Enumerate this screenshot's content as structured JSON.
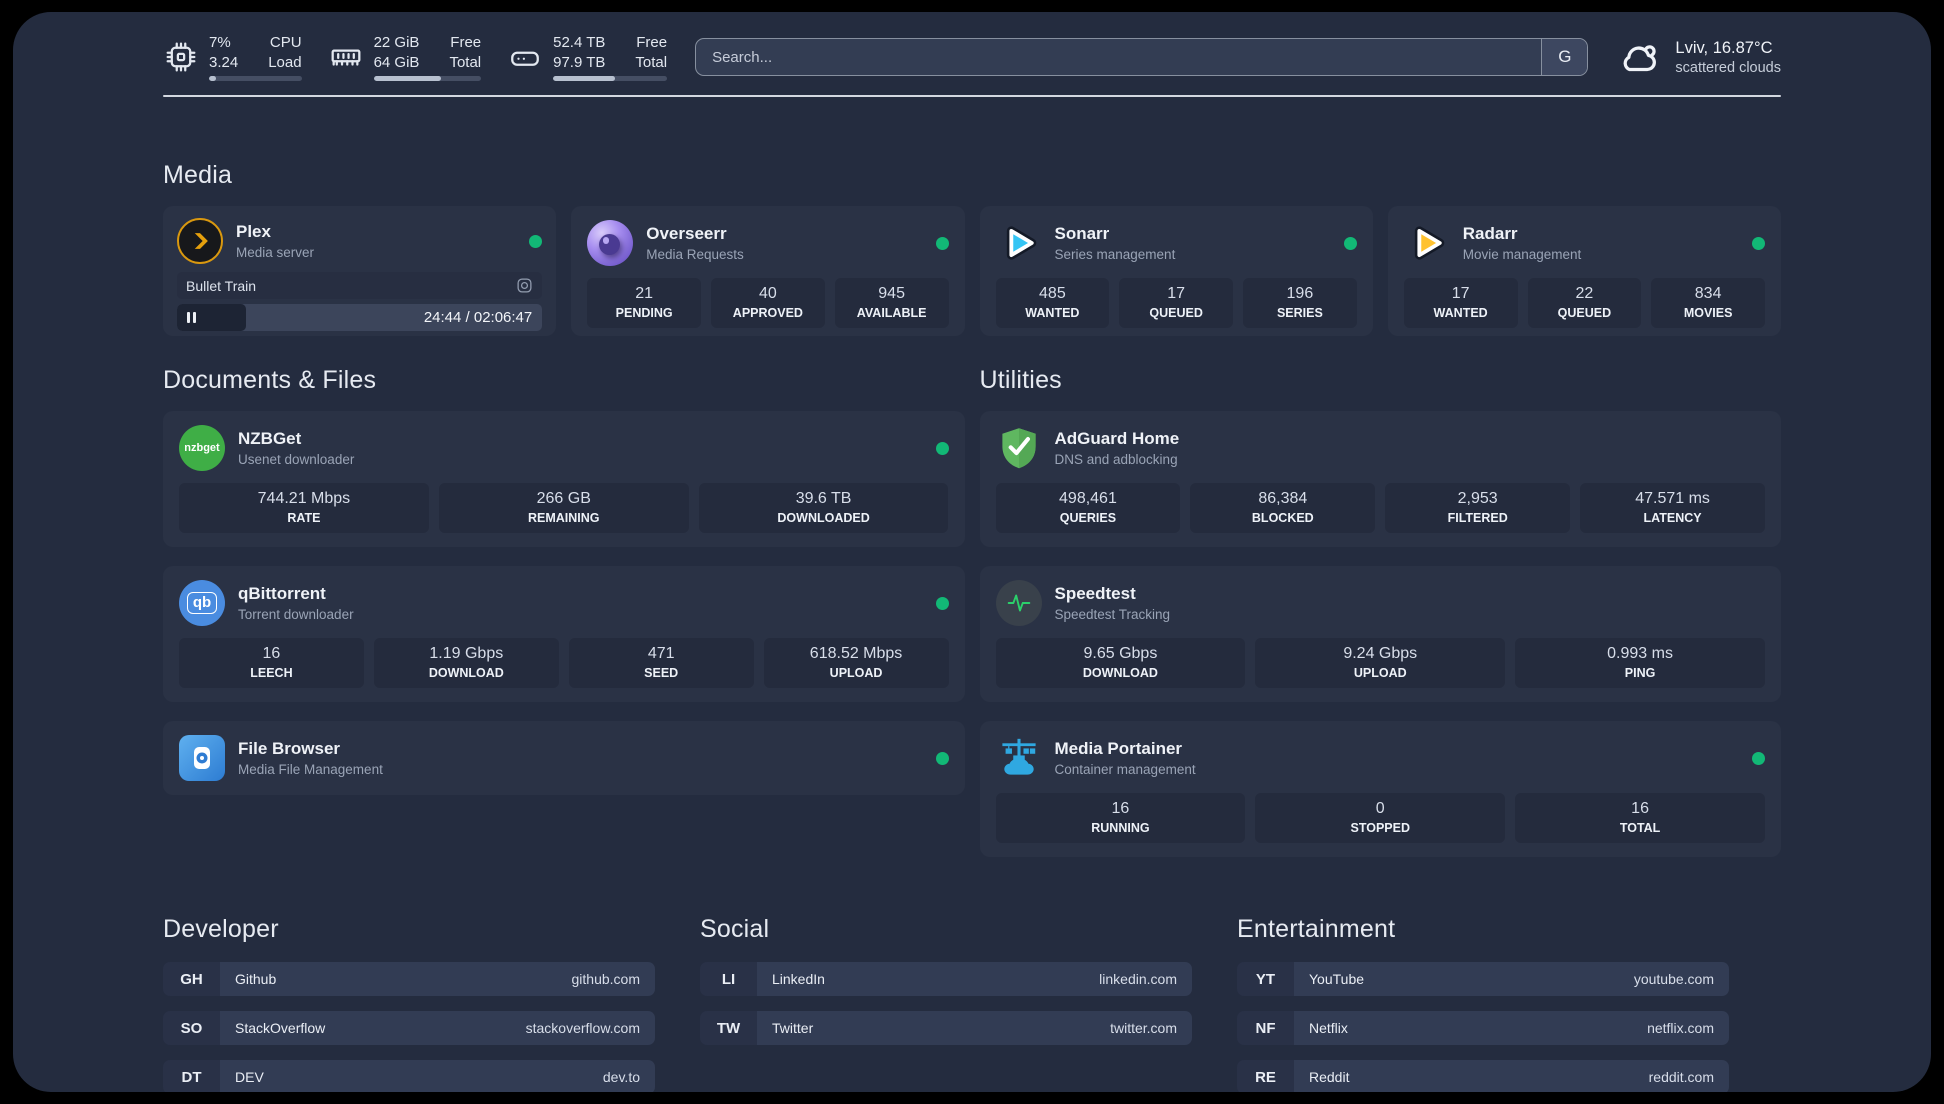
{
  "topbar": {
    "cpu": {
      "value1": "7%",
      "value2": "3.24",
      "label1": "CPU",
      "label2": "Load",
      "progress": 8
    },
    "memory": {
      "value1": "22 GiB",
      "value2": "64 GiB",
      "label1": "Free",
      "label2": "Total",
      "progress": 63
    },
    "storage": {
      "value1": "52.4 TB",
      "value2": "97.9 TB",
      "label1": "Free",
      "label2": "Total",
      "progress": 54
    },
    "search": {
      "placeholder": "Search...",
      "engine_button": "G"
    },
    "weather": {
      "location": "Lviv, 16.87°C",
      "condition": "scattered clouds"
    }
  },
  "sections": {
    "media": "Media",
    "documents": "Documents & Files",
    "utilities": "Utilities",
    "developer": "Developer",
    "social": "Social",
    "entertainment": "Entertainment"
  },
  "apps": {
    "plex": {
      "name": "Plex",
      "description": "Media server",
      "now_playing": "Bullet Train",
      "time_display": "24:44 / 02:06:47",
      "progress": 19
    },
    "overseerr": {
      "name": "Overseerr",
      "description": "Media Requests",
      "stats": [
        {
          "value": "21",
          "label": "PENDING"
        },
        {
          "value": "40",
          "label": "APPROVED"
        },
        {
          "value": "945",
          "label": "AVAILABLE"
        }
      ]
    },
    "sonarr": {
      "name": "Sonarr",
      "description": "Series management",
      "stats": [
        {
          "value": "485",
          "label": "WANTED"
        },
        {
          "value": "17",
          "label": "QUEUED"
        },
        {
          "value": "196",
          "label": "SERIES"
        }
      ]
    },
    "radarr": {
      "name": "Radarr",
      "description": "Movie management",
      "stats": [
        {
          "value": "17",
          "label": "WANTED"
        },
        {
          "value": "22",
          "label": "QUEUED"
        },
        {
          "value": "834",
          "label": "MOVIES"
        }
      ]
    },
    "nzbget": {
      "name": "NZBGet",
      "description": "Usenet downloader",
      "icon_text": "nzbget",
      "stats": [
        {
          "value": "744.21 Mbps",
          "label": "RATE"
        },
        {
          "value": "266 GB",
          "label": "REMAINING"
        },
        {
          "value": "39.6 TB",
          "label": "DOWNLOADED"
        }
      ]
    },
    "qbittorrent": {
      "name": "qBittorrent",
      "description": "Torrent downloader",
      "icon_text": "qb",
      "stats": [
        {
          "value": "16",
          "label": "LEECH"
        },
        {
          "value": "1.19 Gbps",
          "label": "DOWNLOAD"
        },
        {
          "value": "471",
          "label": "SEED"
        },
        {
          "value": "618.52 Mbps",
          "label": "UPLOAD"
        }
      ]
    },
    "filebrowser": {
      "name": "File Browser",
      "description": "Media File Management"
    },
    "adguard": {
      "name": "AdGuard Home",
      "description": "DNS and adblocking",
      "stats": [
        {
          "value": "498,461",
          "label": "QUERIES"
        },
        {
          "value": "86,384",
          "label": "BLOCKED"
        },
        {
          "value": "2,953",
          "label": "FILTERED"
        },
        {
          "value": "47.571 ms",
          "label": "LATENCY"
        }
      ]
    },
    "speedtest": {
      "name": "Speedtest",
      "description": "Speedtest Tracking",
      "stats": [
        {
          "value": "9.65 Gbps",
          "label": "DOWNLOAD"
        },
        {
          "value": "9.24 Gbps",
          "label": "UPLOAD"
        },
        {
          "value": "0.993 ms",
          "label": "PING"
        }
      ]
    },
    "portainer": {
      "name": "Media Portainer",
      "description": "Container management",
      "stats": [
        {
          "value": "16",
          "label": "RUNNING"
        },
        {
          "value": "0",
          "label": "STOPPED"
        },
        {
          "value": "16",
          "label": "TOTAL"
        }
      ]
    }
  },
  "links": {
    "developer": [
      {
        "abbr": "GH",
        "name": "Github",
        "url": "github.com"
      },
      {
        "abbr": "SO",
        "name": "StackOverflow",
        "url": "stackoverflow.com"
      },
      {
        "abbr": "DT",
        "name": "DEV",
        "url": "dev.to"
      }
    ],
    "social": [
      {
        "abbr": "LI",
        "name": "LinkedIn",
        "url": "linkedin.com"
      },
      {
        "abbr": "TW",
        "name": "Twitter",
        "url": "twitter.com"
      }
    ],
    "entertainment": [
      {
        "abbr": "YT",
        "name": "YouTube",
        "url": "youtube.com"
      },
      {
        "abbr": "NF",
        "name": "Netflix",
        "url": "netflix.com"
      },
      {
        "abbr": "RE",
        "name": "Reddit",
        "url": "reddit.com"
      }
    ]
  },
  "colors": {
    "status_online": "#12b876",
    "plex_accent": "#e5a00d",
    "sonarr_accent": "#35c5f4",
    "radarr_accent": "#ffc230",
    "adguard_accent": "#5fb760",
    "portainer_accent": "#2fa8e1",
    "speedtest_accent": "#2bd06b"
  }
}
